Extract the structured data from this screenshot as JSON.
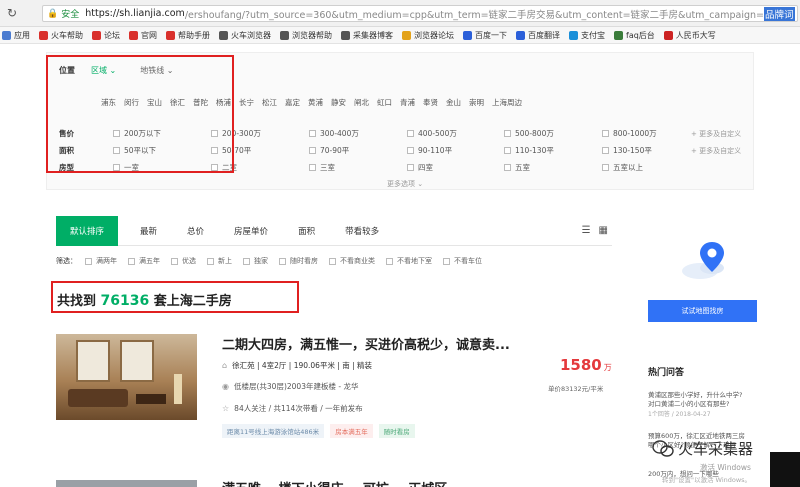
{
  "browser": {
    "secure_label": "安全",
    "url_host": "https://sh.lianjia.com",
    "url_rest": "/ershoufang/?utm_source=360&utm_medium=cpp&utm_term=链家二手房交易&utm_content=链家二手房&utm_campaign=",
    "url_highlight": "品牌词"
  },
  "bookmarks": [
    {
      "label": "应用",
      "color": "#4a7bd0"
    },
    {
      "label": "火车帮助",
      "color": "#d9302c"
    },
    {
      "label": "论坛",
      "color": "#d9302c"
    },
    {
      "label": "官网",
      "color": "#d9302c"
    },
    {
      "label": "帮助手册",
      "color": "#d9302c"
    },
    {
      "label": "火车浏览器",
      "color": "#555555"
    },
    {
      "label": "浏览器帮助",
      "color": "#555555"
    },
    {
      "label": "采集器博客",
      "color": "#555555"
    },
    {
      "label": "浏览器论坛",
      "color": "#e3a21a"
    },
    {
      "label": "百度一下",
      "color": "#2b5fd9"
    },
    {
      "label": "百度翻译",
      "color": "#2b5fd9"
    },
    {
      "label": "支付宝",
      "color": "#1a8fd9"
    },
    {
      "label": "faq后台",
      "color": "#3a7c3a"
    },
    {
      "label": "人民币大写",
      "color": "#cc2222"
    }
  ],
  "filters": {
    "location_label": "位置",
    "tab_area": "区域",
    "tab_metro": "地铁线",
    "districts": [
      "浦东",
      "闵行",
      "宝山",
      "徐汇",
      "普陀",
      "杨浦",
      "长宁",
      "松江",
      "嘉定",
      "黄浦",
      "静安",
      "闸北",
      "虹口",
      "青浦",
      "奉贤",
      "金山",
      "崇明",
      "上海周边"
    ],
    "price_label": "售价",
    "price_options": [
      "200万以下",
      "200-300万",
      "300-400万",
      "400-500万",
      "500-800万",
      "800-1000万"
    ],
    "area_label": "面积",
    "area_options": [
      "50平以下",
      "50-70平",
      "70-90平",
      "90-110平",
      "110-130平",
      "130-150平"
    ],
    "layout_label": "房型",
    "layout_options": [
      "一室",
      "二室",
      "三室",
      "四室",
      "五室",
      "五室以上"
    ],
    "more_custom": "+ 更多及自定义",
    "more_options": "更多选项 ⌄"
  },
  "sort": {
    "tabs": [
      "默认排序",
      "最新",
      "总价",
      "房屋单价",
      "面积",
      "带看较多"
    ],
    "active_index": 0
  },
  "filter_row2": {
    "label": "筛选：",
    "options": [
      "满两年",
      "满五年",
      "优选",
      "新上",
      "独家",
      "随时看房",
      "不看商业类",
      "不看地下室",
      "不看车位"
    ]
  },
  "result": {
    "prefix": "共找到",
    "count": "76136",
    "suffix": "套上海二手房"
  },
  "listing": {
    "title": "二期大四房，满五惟一，买进价高税少，诚意卖...",
    "house_info": "徐汇苑 | 4室2厅 | 190.06平米 | 南 | 精装",
    "position_info": "低楼层(共30层)2003年建板楼 - 龙华",
    "follow_info": "84人关注 / 共114次带看 / 一年前发布",
    "tags": [
      "距离11号线上海游泳馆站486米",
      "房本满五年",
      "随时看房"
    ],
    "total_price": "1580",
    "price_unit": "万",
    "unit_price": "单价83132元/平米"
  },
  "next_listing": {
    "title": "满五唯一  楼下小得庄... 可扩... 正城区"
  },
  "sidebar": {
    "map_button": "试试地图找房",
    "qa_title": "热门问答",
    "qa_items": [
      {
        "q": "黄浦区那些小学好，升什么中学?",
        "q2": "对口黄浦二小的小区有那些?",
        "meta": "1个回答 / 2018-04-27"
      },
      {
        "q": "预算600万，徐汇区近地铁两三房",
        "q2": "哪个小区好?顺便了解一下现行",
        "meta": "200万内，想问一下哪些"
      }
    ]
  },
  "watermark": {
    "text": "火车采集器",
    "activate": "激活 Windows",
    "activate_sub": "转到\"设置\"以激活 Windows。"
  }
}
